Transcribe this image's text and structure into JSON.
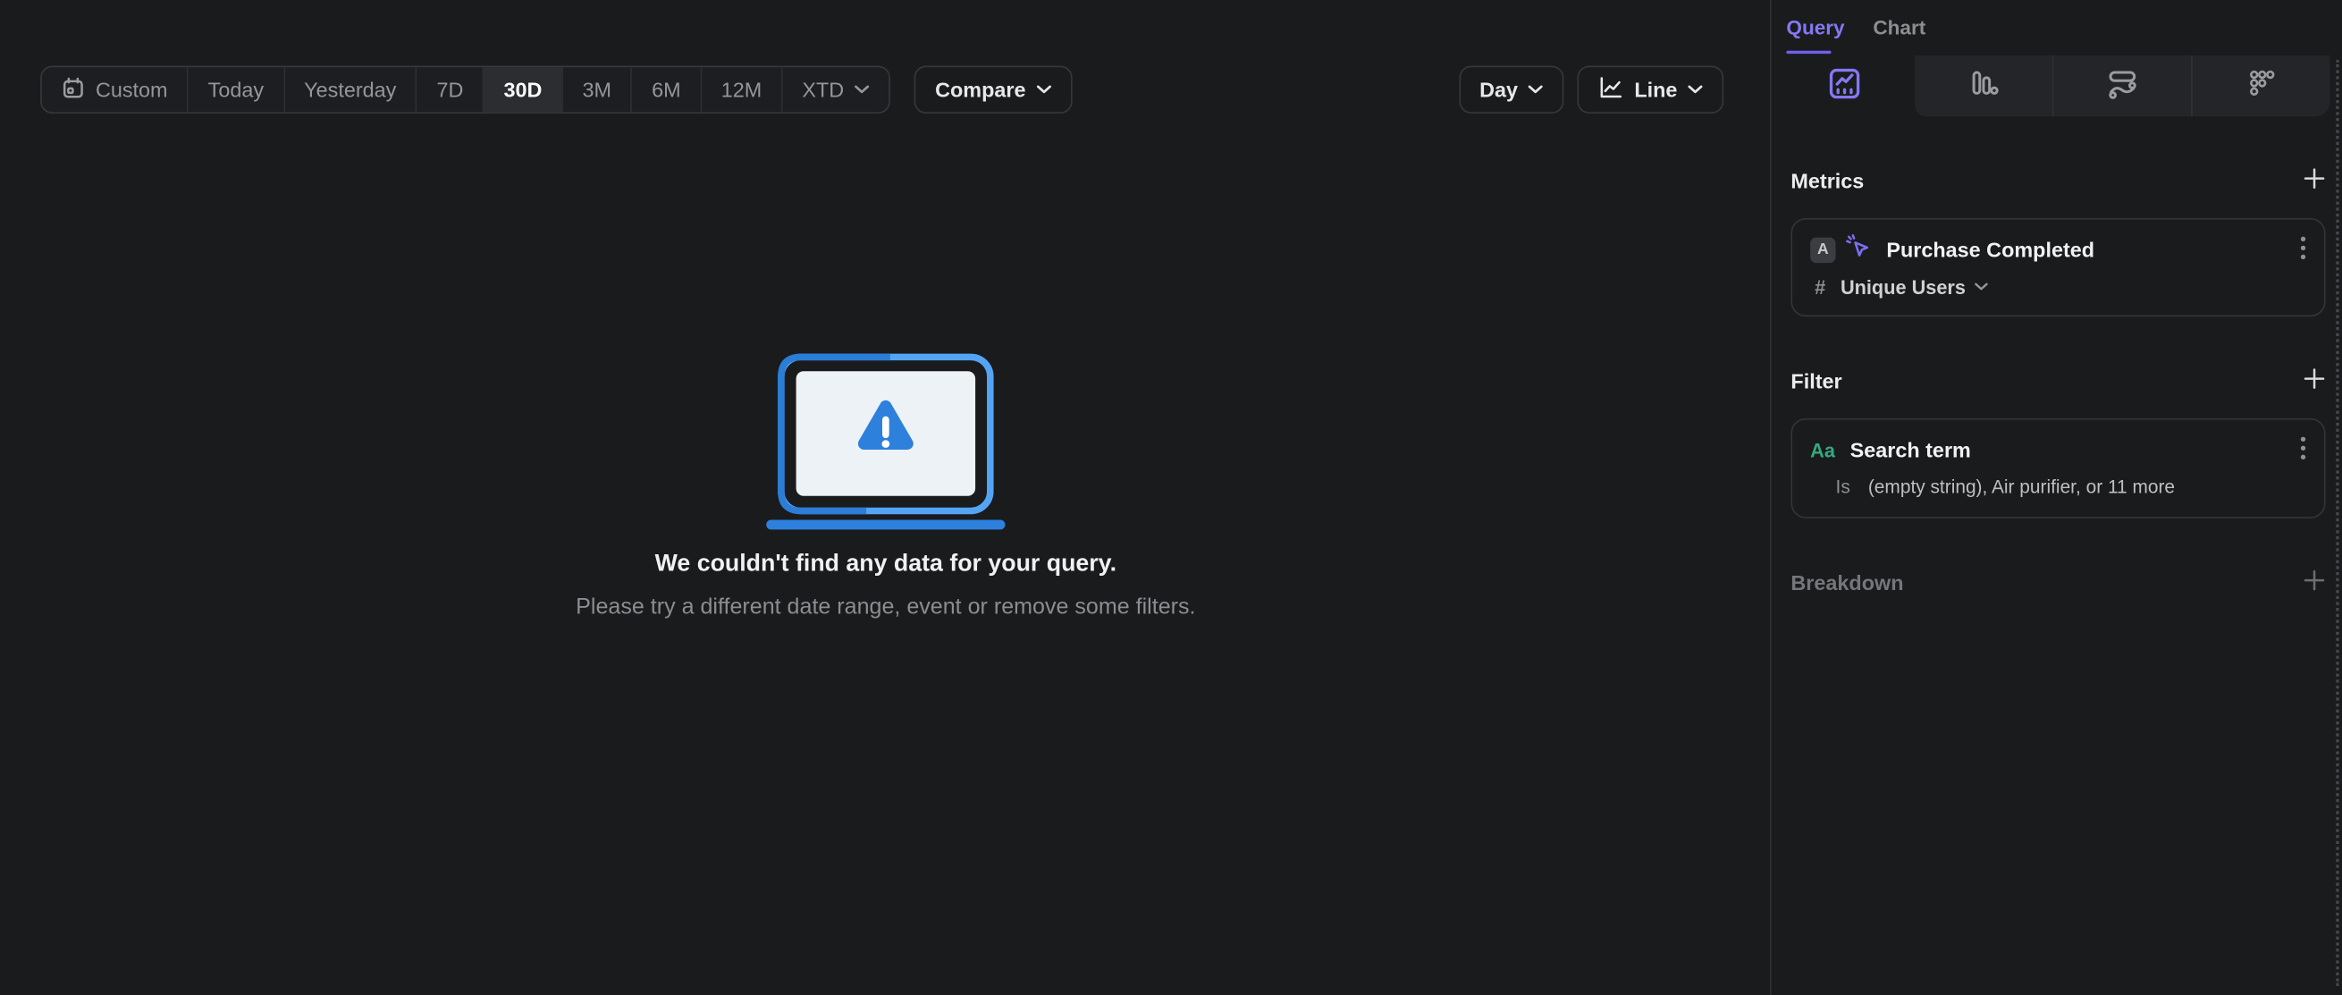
{
  "toolbar": {
    "segments": [
      {
        "label": "Custom"
      },
      {
        "label": "Today"
      },
      {
        "label": "Yesterday"
      },
      {
        "label": "7D"
      },
      {
        "label": "30D",
        "active": true
      },
      {
        "label": "3M"
      },
      {
        "label": "6M"
      },
      {
        "label": "12M"
      },
      {
        "label": "XTD"
      }
    ],
    "compare_label": "Compare"
  },
  "controls": {
    "interval_label": "Day",
    "chart_type_label": "Line"
  },
  "empty_state": {
    "title": "We couldn't find any data for your query.",
    "subtitle": "Please try a different date range, event or remove some filters."
  },
  "sidebar": {
    "tabs": {
      "query": "Query",
      "chart": "Chart"
    },
    "metrics": {
      "title": "Metrics",
      "item": {
        "letter": "A",
        "event": "Purchase Completed",
        "aggregation_symbol": "#",
        "aggregation": "Unique Users"
      }
    },
    "filter": {
      "title": "Filter",
      "item": {
        "type_badge": "Aa",
        "property": "Search term",
        "operator": "Is",
        "values": "(empty string), Air purifier, or 11 more"
      }
    },
    "breakdown": {
      "title": "Breakdown"
    }
  },
  "icons": {
    "calendar-icon": "date range picker",
    "chevron-down-icon": "dropdown indicator",
    "line-chart-icon": "line chart type",
    "insights-tab-icon": "line insights view (active)",
    "bar-chart-tab-icon": "bar view",
    "flows-tab-icon": "flows view",
    "retention-tab-icon": "retention dots view",
    "event-cursor-icon": "event click cursor",
    "kebab-icon": "item options menu",
    "plus-icon": "add item",
    "warning-laptop-icon": "no data illustration"
  },
  "colors": {
    "accent_purple": "#8478f2",
    "green": "#35a97f",
    "blue_dark": "#2b7dd6",
    "blue_light": "#54a4f6",
    "blue_fill": "#2e80dd",
    "background": "#1a1b1d",
    "strip": "#232529"
  }
}
